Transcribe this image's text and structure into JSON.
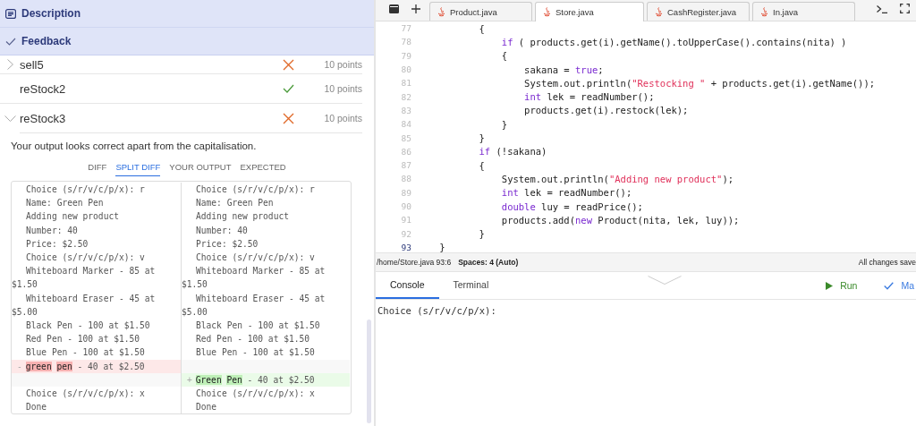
{
  "left_panel": {
    "sections": [
      {
        "kind": "description",
        "label": "Description"
      },
      {
        "kind": "feedback",
        "label": "Feedback"
      }
    ],
    "tests": [
      {
        "name": "sell5",
        "passed": false,
        "expanded": false,
        "points": "10 points"
      },
      {
        "name": "reStock2",
        "passed": true,
        "points": "10 points"
      },
      {
        "name": "reStock3",
        "passed": false,
        "expanded": true,
        "points": "10 points"
      }
    ],
    "message": "Your output looks correct apart from the capitalisation.",
    "diff_tabs": [
      {
        "label": "DIFF",
        "selected": false
      },
      {
        "label": "SPLIT DIFF",
        "selected": true
      },
      {
        "label": "YOUR OUTPUT",
        "selected": false
      },
      {
        "label": "EXPECTED",
        "selected": false
      }
    ],
    "diff_rows": [
      {
        "kind": "same",
        "left": [
          {
            "text": "Choice (s/r/v/c/p/x): r"
          }
        ],
        "right": [
          {
            "text": "Choice (s/r/v/c/p/x): r"
          }
        ]
      },
      {
        "kind": "same",
        "left": [
          {
            "text": "Name: Green Pen"
          }
        ],
        "right": [
          {
            "text": "Name: Green Pen"
          }
        ]
      },
      {
        "kind": "same",
        "left": [
          {
            "text": "Adding new product"
          }
        ],
        "right": [
          {
            "text": "Adding new product"
          }
        ]
      },
      {
        "kind": "same",
        "left": [
          {
            "text": "Number: 40"
          }
        ],
        "right": [
          {
            "text": "Number: 40"
          }
        ]
      },
      {
        "kind": "same",
        "left": [
          {
            "text": "Price: $2.50"
          }
        ],
        "right": [
          {
            "text": "Price: $2.50"
          }
        ]
      },
      {
        "kind": "same",
        "left": [
          {
            "text": "Choice (s/r/v/c/p/x): v"
          }
        ],
        "right": [
          {
            "text": "Choice (s/r/v/c/p/x): v"
          }
        ]
      },
      {
        "kind": "same",
        "left": [
          {
            "text": "Whiteboard Marker - 85 at $1.50"
          }
        ],
        "right": [
          {
            "text": "Whiteboard Marker - 85 at $1.50"
          }
        ]
      },
      {
        "kind": "same",
        "left": [
          {
            "text": "Whiteboard Eraser - 45 at $5.00"
          }
        ],
        "right": [
          {
            "text": "Whiteboard Eraser - 45 at $5.00"
          }
        ]
      },
      {
        "kind": "same",
        "left": [
          {
            "text": "Black Pen - 100 at $1.50"
          }
        ],
        "right": [
          {
            "text": "Black Pen - 100 at $1.50"
          }
        ]
      },
      {
        "kind": "same",
        "left": [
          {
            "text": "Red Pen - 100 at $1.50"
          }
        ],
        "right": [
          {
            "text": "Red Pen - 100 at $1.50"
          }
        ]
      },
      {
        "kind": "same",
        "left": [
          {
            "text": "Blue Pen - 100 at $1.50"
          }
        ],
        "right": [
          {
            "text": "Blue Pen - 100 at $1.50"
          }
        ]
      },
      {
        "kind": "removed",
        "marker": "-",
        "left": [
          {
            "text": "green",
            "changed": true
          },
          {
            "text": "pen",
            "changed": true,
            "spaced": true
          },
          {
            "text": " - 40 at $2.50"
          }
        ]
      },
      {
        "kind": "added",
        "marker": "+",
        "right": [
          {
            "text": "Green",
            "changed": true
          },
          {
            "text": "Pen",
            "changed": true,
            "spaced": true
          },
          {
            "text": " - 40 at $2.50"
          }
        ]
      },
      {
        "kind": "same",
        "left": [
          {
            "text": "Choice (s/r/v/c/p/x): x"
          }
        ],
        "right": [
          {
            "text": "Choice (s/r/v/c/p/x): x"
          }
        ]
      },
      {
        "kind": "same",
        "left": [
          {
            "text": "Done"
          }
        ],
        "right": [
          {
            "text": "Done"
          }
        ]
      }
    ]
  },
  "editor": {
    "tabs": [
      {
        "label": "Product.java",
        "selected": false
      },
      {
        "label": "Store.java",
        "selected": true
      },
      {
        "label": "CashRegister.java",
        "selected": false
      },
      {
        "label": "In.java",
        "selected": false
      }
    ],
    "lines": [
      {
        "number": "77",
        "current": false,
        "tokens": [
          {
            "kind": "plain",
            "text": "           {"
          }
        ]
      },
      {
        "number": "78",
        "current": false,
        "tokens": [
          {
            "kind": "keyword",
            "text": "               if"
          },
          {
            "kind": "plain",
            "text": " ( products.get(i).getName().toUpperCase().contains(nita) )"
          }
        ]
      },
      {
        "number": "79",
        "current": false,
        "tokens": [
          {
            "kind": "plain",
            "text": "               {"
          }
        ]
      },
      {
        "number": "80",
        "current": false,
        "tokens": [
          {
            "kind": "plain",
            "text": "                   sakana = "
          },
          {
            "kind": "keyword",
            "text": "true"
          },
          {
            "kind": "plain",
            "text": ";"
          }
        ]
      },
      {
        "number": "81",
        "current": false,
        "tokens": [
          {
            "kind": "plain",
            "text": "                   System.out.println("
          },
          {
            "kind": "string",
            "text": "\"Restocking \""
          },
          {
            "kind": "plain",
            "text": " + products.get(i).getName());"
          }
        ]
      },
      {
        "number": "82",
        "current": false,
        "tokens": [
          {
            "kind": "keyword",
            "text": "                   int"
          },
          {
            "kind": "plain",
            "text": " lek = readNumber();"
          }
        ]
      },
      {
        "number": "83",
        "current": false,
        "tokens": [
          {
            "kind": "plain",
            "text": "                   products.get(i).restock(lek);"
          }
        ]
      },
      {
        "number": "84",
        "current": false,
        "tokens": [
          {
            "kind": "plain",
            "text": "               }"
          }
        ]
      },
      {
        "number": "85",
        "current": false,
        "tokens": [
          {
            "kind": "plain",
            "text": "           }"
          }
        ]
      },
      {
        "number": "86",
        "current": false,
        "tokens": [
          {
            "kind": "keyword",
            "text": "           if"
          },
          {
            "kind": "plain",
            "text": " (!sakana)"
          }
        ]
      },
      {
        "number": "87",
        "current": false,
        "tokens": [
          {
            "kind": "plain",
            "text": "           {"
          }
        ]
      },
      {
        "number": "88",
        "current": false,
        "tokens": [
          {
            "kind": "plain",
            "text": "               System.out.println("
          },
          {
            "kind": "string",
            "text": "\"Adding new product\""
          },
          {
            "kind": "plain",
            "text": ");"
          }
        ]
      },
      {
        "number": "89",
        "current": false,
        "tokens": [
          {
            "kind": "keyword",
            "text": "               int"
          },
          {
            "kind": "plain",
            "text": " lek = readNumber();"
          }
        ]
      },
      {
        "number": "90",
        "current": false,
        "tokens": [
          {
            "kind": "keyword",
            "text": "               double"
          },
          {
            "kind": "plain",
            "text": " luy = readPrice();"
          }
        ]
      },
      {
        "number": "91",
        "current": false,
        "tokens": [
          {
            "kind": "plain",
            "text": "               products.add("
          },
          {
            "kind": "keyword",
            "text": "new"
          },
          {
            "kind": "plain",
            "text": " Product(nita, lek, luy));"
          }
        ]
      },
      {
        "number": "92",
        "current": false,
        "tokens": [
          {
            "kind": "plain",
            "text": "           }"
          }
        ]
      },
      {
        "number": "93",
        "current": true,
        "tokens": [
          {
            "kind": "plain",
            "text": "    }"
          }
        ]
      }
    ]
  },
  "status_bar": {
    "path": "/home/Store.java 93:6",
    "spaces": "Spaces: 4 (Auto)",
    "saved": "All changes save"
  },
  "console": {
    "tabs": [
      {
        "label": "Console",
        "selected": true
      },
      {
        "label": "Terminal",
        "selected": false
      }
    ],
    "run_label": "Run",
    "mark_label": "Ma",
    "output": "Choice (s/r/v/c/p/x):"
  }
}
